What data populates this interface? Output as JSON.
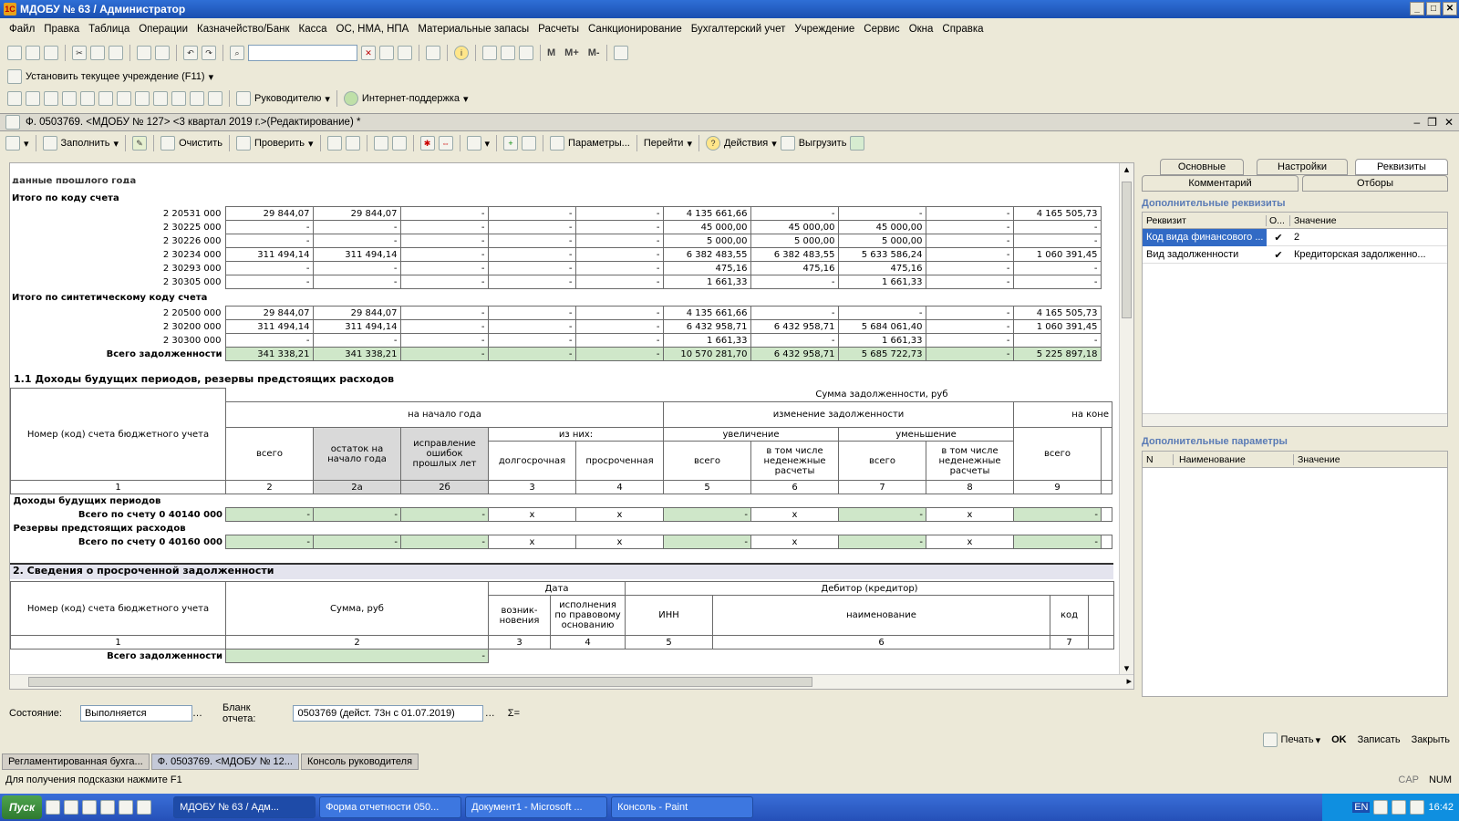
{
  "app": {
    "title": "МДОБУ № 63 / Администратор"
  },
  "menu": [
    "Файл",
    "Правка",
    "Таблица",
    "Операции",
    "Казначейство/Банк",
    "Касса",
    "ОС, НМА, НПА",
    "Материальные запасы",
    "Расчеты",
    "Санкционирование",
    "Бухгалтерский учет",
    "Учреждение",
    "Сервис",
    "Окна",
    "Справка"
  ],
  "toolbar3": {
    "set_org": "Установить текущее учреждение (F11)"
  },
  "toolbar4": {
    "manager": "Руководителю",
    "support": "Интернет-поддержка"
  },
  "doc": {
    "title": "Ф. 0503769. <МДОБУ № 127> <3 квартал 2019 г.>(Редактирование) *"
  },
  "doctb": {
    "fill": "Заполнить",
    "clear": "Очистить",
    "check": "Проверить",
    "params": "Параметры...",
    "goto": "Перейти",
    "actions": "Действия",
    "export": "Выгрузить"
  },
  "sheet": {
    "partial": "данные прошлого года",
    "s1": {
      "head": "Итого по коду счета",
      "rows": [
        [
          "2 20531 000",
          "29 844,07",
          "29 844,07",
          "-",
          "-",
          "-",
          "4 135 661,66",
          "-",
          "-",
          "-",
          "4 165 505,73"
        ],
        [
          "2 30225 000",
          "-",
          "-",
          "-",
          "-",
          "-",
          "45 000,00",
          "45 000,00",
          "45 000,00",
          "-",
          "-"
        ],
        [
          "2 30226 000",
          "-",
          "-",
          "-",
          "-",
          "-",
          "5 000,00",
          "5 000,00",
          "5 000,00",
          "-",
          "-"
        ],
        [
          "2 30234 000",
          "311 494,14",
          "311 494,14",
          "-",
          "-",
          "-",
          "6 382 483,55",
          "6 382 483,55",
          "5 633 586,24",
          "-",
          "1 060 391,45"
        ],
        [
          "2 30293 000",
          "-",
          "-",
          "-",
          "-",
          "-",
          "475,16",
          "475,16",
          "475,16",
          "-",
          "-"
        ],
        [
          "2 30305 000",
          "-",
          "-",
          "-",
          "-",
          "-",
          "1 661,33",
          "-",
          "1 661,33",
          "-",
          "-"
        ]
      ]
    },
    "s2": {
      "head": "Итого по синтетическому коду счета",
      "rows": [
        [
          "2 20500 000",
          "29 844,07",
          "29 844,07",
          "-",
          "-",
          "-",
          "4 135 661,66",
          "-",
          "-",
          "-",
          "4 165 505,73"
        ],
        [
          "2 30200 000",
          "311 494,14",
          "311 494,14",
          "-",
          "-",
          "-",
          "6 432 958,71",
          "6 432 958,71",
          "5 684 061,40",
          "-",
          "1 060 391,45"
        ],
        [
          "2 30300 000",
          "-",
          "-",
          "-",
          "-",
          "-",
          "1 661,33",
          "-",
          "1 661,33",
          "-",
          "-"
        ]
      ],
      "total": [
        "Всего задолженности",
        "341 338,21",
        "341 338,21",
        "-",
        "-",
        "-",
        "10 570 281,70",
        "6 432 958,71",
        "5 685 722,73",
        "-",
        "5 225 897,18"
      ]
    },
    "sec11": {
      "title": "1.1 Доходы будущих периодов, резервы предстоящих расходов",
      "h_code": "Номер (код) счета бюджетного учета",
      "h_sum": "Сумма задолженности, руб",
      "h_start": "на начало года",
      "h_change": "изменение задолженности",
      "h_end": "на коне",
      "h_ofthem": "из них:",
      "h_inc": "увеличение",
      "h_dec": "уменьшение",
      "h_total": "всего",
      "h_rest": "остаток на начало года",
      "h_fix": "исправление ошибок прошлых лет",
      "h_long": "долгосрочная",
      "h_over": "просроченная",
      "h_incl": "в том числе неденежные расчеты",
      "nums": [
        "1",
        "2",
        "2а",
        "2б",
        "3",
        "4",
        "5",
        "6",
        "7",
        "8",
        "9"
      ],
      "g1": "Доходы будущих периодов",
      "t1": "Всего по счету 0 40140 000",
      "g2": "Резервы предстоящих расходов",
      "t2": "Всего по счету 0 40160 000",
      "dash": "-",
      "x": "x"
    },
    "sec2": {
      "title": "2. Сведения о просроченной задолженности",
      "h_code": "Номер (код) счета бюджетного учета",
      "h_sum": "Сумма, руб",
      "h_date": "Дата",
      "h_debtor": "Дебитор (кредитор)",
      "h_occ": "возник-новения",
      "h_exec": "исполнения по правовому основанию",
      "h_inn": "ИНН",
      "h_name": "наименование",
      "h_kod": "код",
      "nums": [
        "1",
        "2",
        "3",
        "4",
        "5",
        "6",
        "7"
      ],
      "total": "Всего задолженности",
      "dash": "-"
    }
  },
  "status": {
    "state_label": "Состояние:",
    "state_value": "Выполняется",
    "blank_label": "Бланк отчета:",
    "blank_value": "0503769 (дейст. 73н с 01.07.2019)",
    "sigma": "Σ="
  },
  "rpanel": {
    "tabs": [
      "Основные",
      "Настройки",
      "Реквизиты",
      "Комментарий",
      "Отборы"
    ],
    "addreq": "Дополнительные реквизиты",
    "cols": [
      "Реквизит",
      "О...",
      "Значение"
    ],
    "rows": [
      {
        "name": "Код вида финансового ...",
        "val": "2"
      },
      {
        "name": "Вид задолженности",
        "val": "Кредиторская задолженно..."
      }
    ],
    "addparams": "Дополнительные параметры",
    "pcols": [
      "N",
      "Наименование",
      "Значение"
    ]
  },
  "bottom": {
    "print": "Печать",
    "ok": "OK",
    "save": "Записать",
    "close": "Закрыть"
  },
  "wintabs": [
    "Регламентированная бухга...",
    "Ф. 0503769. <МДОБУ № 12...",
    "Консоль руководителя"
  ],
  "hint": "Для получения подсказки нажмите F1",
  "indicators": [
    "CAP",
    "NUM"
  ],
  "taskbar": {
    "start": "Пуск",
    "tasks": [
      "МДОБУ № 63 / Адм...",
      "Форма отчетности 050...",
      "Документ1 - Microsoft ...",
      "Консоль - Paint"
    ],
    "lang": "EN",
    "time": "16:42"
  }
}
